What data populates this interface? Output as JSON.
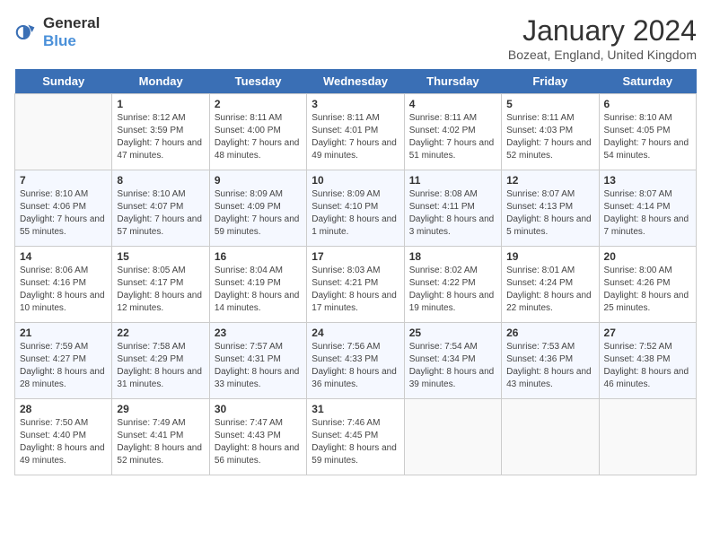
{
  "logo": {
    "line1": "General",
    "line2": "Blue"
  },
  "title": "January 2024",
  "subtitle": "Bozeat, England, United Kingdom",
  "days_of_week": [
    "Sunday",
    "Monday",
    "Tuesday",
    "Wednesday",
    "Thursday",
    "Friday",
    "Saturday"
  ],
  "weeks": [
    [
      {
        "num": "",
        "sunrise": "",
        "sunset": "",
        "daylight": ""
      },
      {
        "num": "1",
        "sunrise": "Sunrise: 8:12 AM",
        "sunset": "Sunset: 3:59 PM",
        "daylight": "Daylight: 7 hours and 47 minutes."
      },
      {
        "num": "2",
        "sunrise": "Sunrise: 8:11 AM",
        "sunset": "Sunset: 4:00 PM",
        "daylight": "Daylight: 7 hours and 48 minutes."
      },
      {
        "num": "3",
        "sunrise": "Sunrise: 8:11 AM",
        "sunset": "Sunset: 4:01 PM",
        "daylight": "Daylight: 7 hours and 49 minutes."
      },
      {
        "num": "4",
        "sunrise": "Sunrise: 8:11 AM",
        "sunset": "Sunset: 4:02 PM",
        "daylight": "Daylight: 7 hours and 51 minutes."
      },
      {
        "num": "5",
        "sunrise": "Sunrise: 8:11 AM",
        "sunset": "Sunset: 4:03 PM",
        "daylight": "Daylight: 7 hours and 52 minutes."
      },
      {
        "num": "6",
        "sunrise": "Sunrise: 8:10 AM",
        "sunset": "Sunset: 4:05 PM",
        "daylight": "Daylight: 7 hours and 54 minutes."
      }
    ],
    [
      {
        "num": "7",
        "sunrise": "Sunrise: 8:10 AM",
        "sunset": "Sunset: 4:06 PM",
        "daylight": "Daylight: 7 hours and 55 minutes."
      },
      {
        "num": "8",
        "sunrise": "Sunrise: 8:10 AM",
        "sunset": "Sunset: 4:07 PM",
        "daylight": "Daylight: 7 hours and 57 minutes."
      },
      {
        "num": "9",
        "sunrise": "Sunrise: 8:09 AM",
        "sunset": "Sunset: 4:09 PM",
        "daylight": "Daylight: 7 hours and 59 minutes."
      },
      {
        "num": "10",
        "sunrise": "Sunrise: 8:09 AM",
        "sunset": "Sunset: 4:10 PM",
        "daylight": "Daylight: 8 hours and 1 minute."
      },
      {
        "num": "11",
        "sunrise": "Sunrise: 8:08 AM",
        "sunset": "Sunset: 4:11 PM",
        "daylight": "Daylight: 8 hours and 3 minutes."
      },
      {
        "num": "12",
        "sunrise": "Sunrise: 8:07 AM",
        "sunset": "Sunset: 4:13 PM",
        "daylight": "Daylight: 8 hours and 5 minutes."
      },
      {
        "num": "13",
        "sunrise": "Sunrise: 8:07 AM",
        "sunset": "Sunset: 4:14 PM",
        "daylight": "Daylight: 8 hours and 7 minutes."
      }
    ],
    [
      {
        "num": "14",
        "sunrise": "Sunrise: 8:06 AM",
        "sunset": "Sunset: 4:16 PM",
        "daylight": "Daylight: 8 hours and 10 minutes."
      },
      {
        "num": "15",
        "sunrise": "Sunrise: 8:05 AM",
        "sunset": "Sunset: 4:17 PM",
        "daylight": "Daylight: 8 hours and 12 minutes."
      },
      {
        "num": "16",
        "sunrise": "Sunrise: 8:04 AM",
        "sunset": "Sunset: 4:19 PM",
        "daylight": "Daylight: 8 hours and 14 minutes."
      },
      {
        "num": "17",
        "sunrise": "Sunrise: 8:03 AM",
        "sunset": "Sunset: 4:21 PM",
        "daylight": "Daylight: 8 hours and 17 minutes."
      },
      {
        "num": "18",
        "sunrise": "Sunrise: 8:02 AM",
        "sunset": "Sunset: 4:22 PM",
        "daylight": "Daylight: 8 hours and 19 minutes."
      },
      {
        "num": "19",
        "sunrise": "Sunrise: 8:01 AM",
        "sunset": "Sunset: 4:24 PM",
        "daylight": "Daylight: 8 hours and 22 minutes."
      },
      {
        "num": "20",
        "sunrise": "Sunrise: 8:00 AM",
        "sunset": "Sunset: 4:26 PM",
        "daylight": "Daylight: 8 hours and 25 minutes."
      }
    ],
    [
      {
        "num": "21",
        "sunrise": "Sunrise: 7:59 AM",
        "sunset": "Sunset: 4:27 PM",
        "daylight": "Daylight: 8 hours and 28 minutes."
      },
      {
        "num": "22",
        "sunrise": "Sunrise: 7:58 AM",
        "sunset": "Sunset: 4:29 PM",
        "daylight": "Daylight: 8 hours and 31 minutes."
      },
      {
        "num": "23",
        "sunrise": "Sunrise: 7:57 AM",
        "sunset": "Sunset: 4:31 PM",
        "daylight": "Daylight: 8 hours and 33 minutes."
      },
      {
        "num": "24",
        "sunrise": "Sunrise: 7:56 AM",
        "sunset": "Sunset: 4:33 PM",
        "daylight": "Daylight: 8 hours and 36 minutes."
      },
      {
        "num": "25",
        "sunrise": "Sunrise: 7:54 AM",
        "sunset": "Sunset: 4:34 PM",
        "daylight": "Daylight: 8 hours and 39 minutes."
      },
      {
        "num": "26",
        "sunrise": "Sunrise: 7:53 AM",
        "sunset": "Sunset: 4:36 PM",
        "daylight": "Daylight: 8 hours and 43 minutes."
      },
      {
        "num": "27",
        "sunrise": "Sunrise: 7:52 AM",
        "sunset": "Sunset: 4:38 PM",
        "daylight": "Daylight: 8 hours and 46 minutes."
      }
    ],
    [
      {
        "num": "28",
        "sunrise": "Sunrise: 7:50 AM",
        "sunset": "Sunset: 4:40 PM",
        "daylight": "Daylight: 8 hours and 49 minutes."
      },
      {
        "num": "29",
        "sunrise": "Sunrise: 7:49 AM",
        "sunset": "Sunset: 4:41 PM",
        "daylight": "Daylight: 8 hours and 52 minutes."
      },
      {
        "num": "30",
        "sunrise": "Sunrise: 7:47 AM",
        "sunset": "Sunset: 4:43 PM",
        "daylight": "Daylight: 8 hours and 56 minutes."
      },
      {
        "num": "31",
        "sunrise": "Sunrise: 7:46 AM",
        "sunset": "Sunset: 4:45 PM",
        "daylight": "Daylight: 8 hours and 59 minutes."
      },
      {
        "num": "",
        "sunrise": "",
        "sunset": "",
        "daylight": ""
      },
      {
        "num": "",
        "sunrise": "",
        "sunset": "",
        "daylight": ""
      },
      {
        "num": "",
        "sunrise": "",
        "sunset": "",
        "daylight": ""
      }
    ]
  ]
}
